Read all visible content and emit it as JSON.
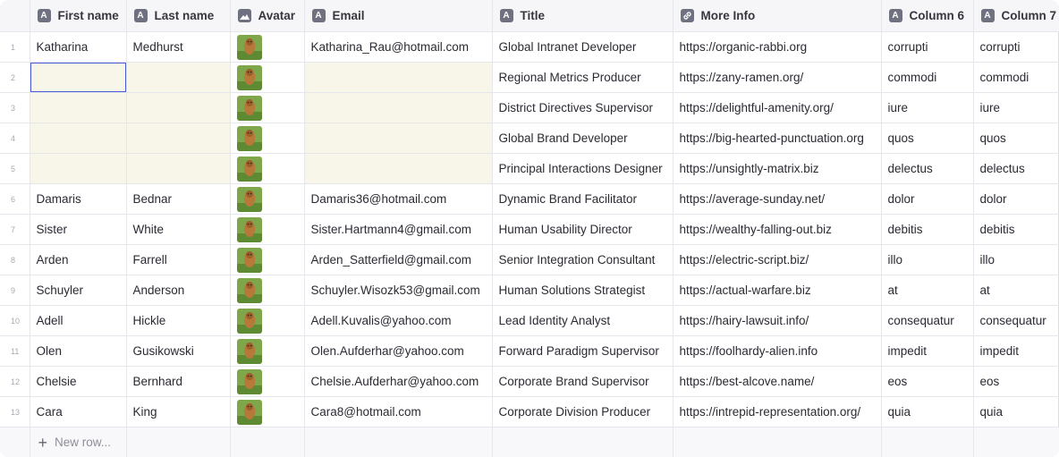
{
  "columns": [
    {
      "label": "First name",
      "icon": "text-type-icon"
    },
    {
      "label": "Last name",
      "icon": "text-type-icon"
    },
    {
      "label": "Avatar",
      "icon": "image-type-icon"
    },
    {
      "label": "Email",
      "icon": "text-type-icon"
    },
    {
      "label": "Title",
      "icon": "text-type-icon"
    },
    {
      "label": "More Info",
      "icon": "link-type-icon"
    },
    {
      "label": "Column 6",
      "icon": "text-type-icon"
    },
    {
      "label": "Column 7",
      "icon": "text-type-icon"
    }
  ],
  "rows": [
    {
      "n": "1",
      "first": "Katharina",
      "last": "Medhurst",
      "email": "Katharina_Rau@hotmail.com",
      "title": "Global Intranet Developer",
      "info": "https://organic-rabbi.org",
      "c6": "corrupti",
      "c7": "corrupti"
    },
    {
      "n": "2",
      "first": "",
      "last": "",
      "email": "",
      "title": "Regional Metrics Producer",
      "info": "https://zany-ramen.org/",
      "c6": "commodi",
      "c7": "commodi"
    },
    {
      "n": "3",
      "first": "",
      "last": "",
      "email": "",
      "title": "District Directives Supervisor",
      "info": "https://delightful-amenity.org/",
      "c6": "iure",
      "c7": "iure"
    },
    {
      "n": "4",
      "first": "",
      "last": "",
      "email": "",
      "title": "Global Brand Developer",
      "info": "https://big-hearted-punctuation.org",
      "c6": "quos",
      "c7": "quos"
    },
    {
      "n": "5",
      "first": "",
      "last": "",
      "email": "",
      "title": "Principal Interactions Designer",
      "info": "https://unsightly-matrix.biz",
      "c6": "delectus",
      "c7": "delectus"
    },
    {
      "n": "6",
      "first": "Damaris",
      "last": "Bednar",
      "email": "Damaris36@hotmail.com",
      "title": "Dynamic Brand Facilitator",
      "info": "https://average-sunday.net/",
      "c6": "dolor",
      "c7": "dolor"
    },
    {
      "n": "7",
      "first": "Sister",
      "last": "White",
      "email": "Sister.Hartmann4@gmail.com",
      "title": "Human Usability Director",
      "info": "https://wealthy-falling-out.biz",
      "c6": "debitis",
      "c7": "debitis"
    },
    {
      "n": "8",
      "first": "Arden",
      "last": "Farrell",
      "email": "Arden_Satterfield@gmail.com",
      "title": "Senior Integration Consultant",
      "info": "https://electric-script.biz/",
      "c6": "illo",
      "c7": "illo"
    },
    {
      "n": "9",
      "first": "Schuyler",
      "last": "Anderson",
      "email": "Schuyler.Wisozk53@gmail.com",
      "title": "Human Solutions Strategist",
      "info": "https://actual-warfare.biz",
      "c6": "at",
      "c7": "at"
    },
    {
      "n": "10",
      "first": "Adell",
      "last": "Hickle",
      "email": "Adell.Kuvalis@yahoo.com",
      "title": "Lead Identity Analyst",
      "info": "https://hairy-lawsuit.info/",
      "c6": "consequatur",
      "c7": "consequatur"
    },
    {
      "n": "11",
      "first": "Olen",
      "last": "Gusikowski",
      "email": "Olen.Aufderhar@yahoo.com",
      "title": "Forward Paradigm Supervisor",
      "info": "https://foolhardy-alien.info",
      "c6": "impedit",
      "c7": "impedit"
    },
    {
      "n": "12",
      "first": "Chelsie",
      "last": "Bernhard",
      "email": "Chelsie.Aufderhar@yahoo.com",
      "title": "Corporate Brand Supervisor",
      "info": "https://best-alcove.name/",
      "c6": "eos",
      "c7": "eos"
    },
    {
      "n": "13",
      "first": "Cara",
      "last": "King",
      "email": "Cara8@hotmail.com",
      "title": "Corporate Division Producer",
      "info": "https://intrepid-representation.org/",
      "c6": "quia",
      "c7": "quia"
    }
  ],
  "new_row_label": "New row...",
  "colors": {
    "header_bg": "#f6f6f8",
    "empty_cell_bg": "#f8f6e8",
    "focus_border": "#4a5bd6",
    "grid": "#e6e7ec"
  }
}
